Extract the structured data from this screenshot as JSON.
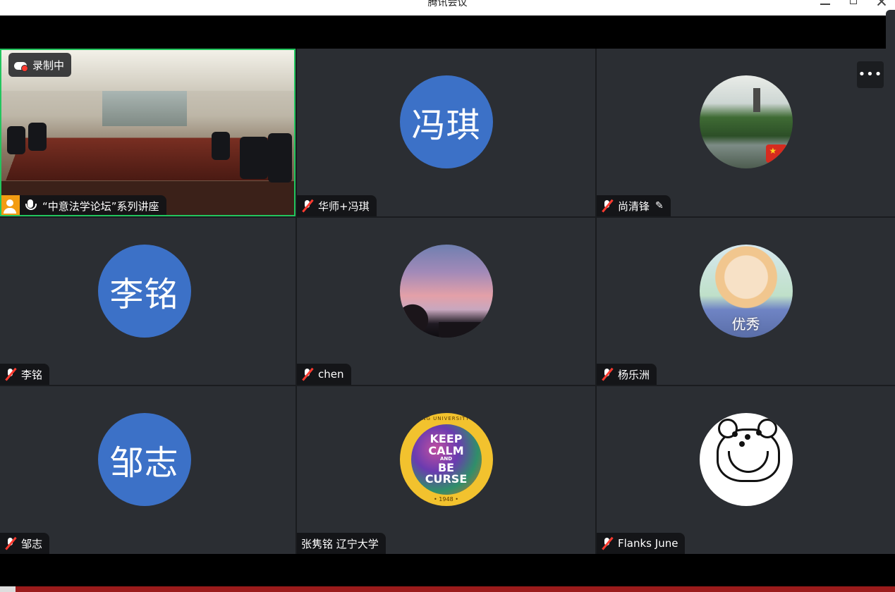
{
  "window": {
    "title": "腾讯会议"
  },
  "recording": {
    "label": "录制中"
  },
  "more_menu": {
    "label": "•••"
  },
  "tiles": [
    {
      "name": "“中意法学论坛”系列讲座",
      "type": "video"
    },
    {
      "name": "华师+冯琪",
      "avatar_text": "冯琪",
      "muted": true
    },
    {
      "name": "尚清锋",
      "avatar_image": "landscape-with-pagoda",
      "muted": true,
      "editing_icon": "pencil-icon"
    },
    {
      "name": "李铭",
      "avatar_text": "李铭",
      "muted": true
    },
    {
      "name": "chen",
      "avatar_image": "sunset-sky",
      "muted": true
    },
    {
      "name": "杨乐洲",
      "avatar_image": "anime-character",
      "avatar_caption": "优秀",
      "muted": true
    },
    {
      "name": "邹志",
      "avatar_text": "邹志",
      "muted": true
    },
    {
      "name": "张隽铭 辽宁大学",
      "avatar_image": "keep-calm-badge",
      "muted": false
    },
    {
      "name": "Flanks June",
      "avatar_image": "cartoon-toad",
      "muted": true
    }
  ],
  "badge_text": {
    "arc": "LIAONING UNIVERSITY CHINA",
    "line1": "KEEP",
    "line2": "CALM",
    "line3": "AND",
    "line4": "BE",
    "line5": "CURSE",
    "year": "• 1948 •"
  },
  "colors": {
    "text_avatar_bg": "#3c71c7",
    "active_speaker_border": "#22c55e",
    "tile_bg": "#2b2e33",
    "muted_slash": "#ff3b30",
    "host_badge": "#f39c12"
  }
}
